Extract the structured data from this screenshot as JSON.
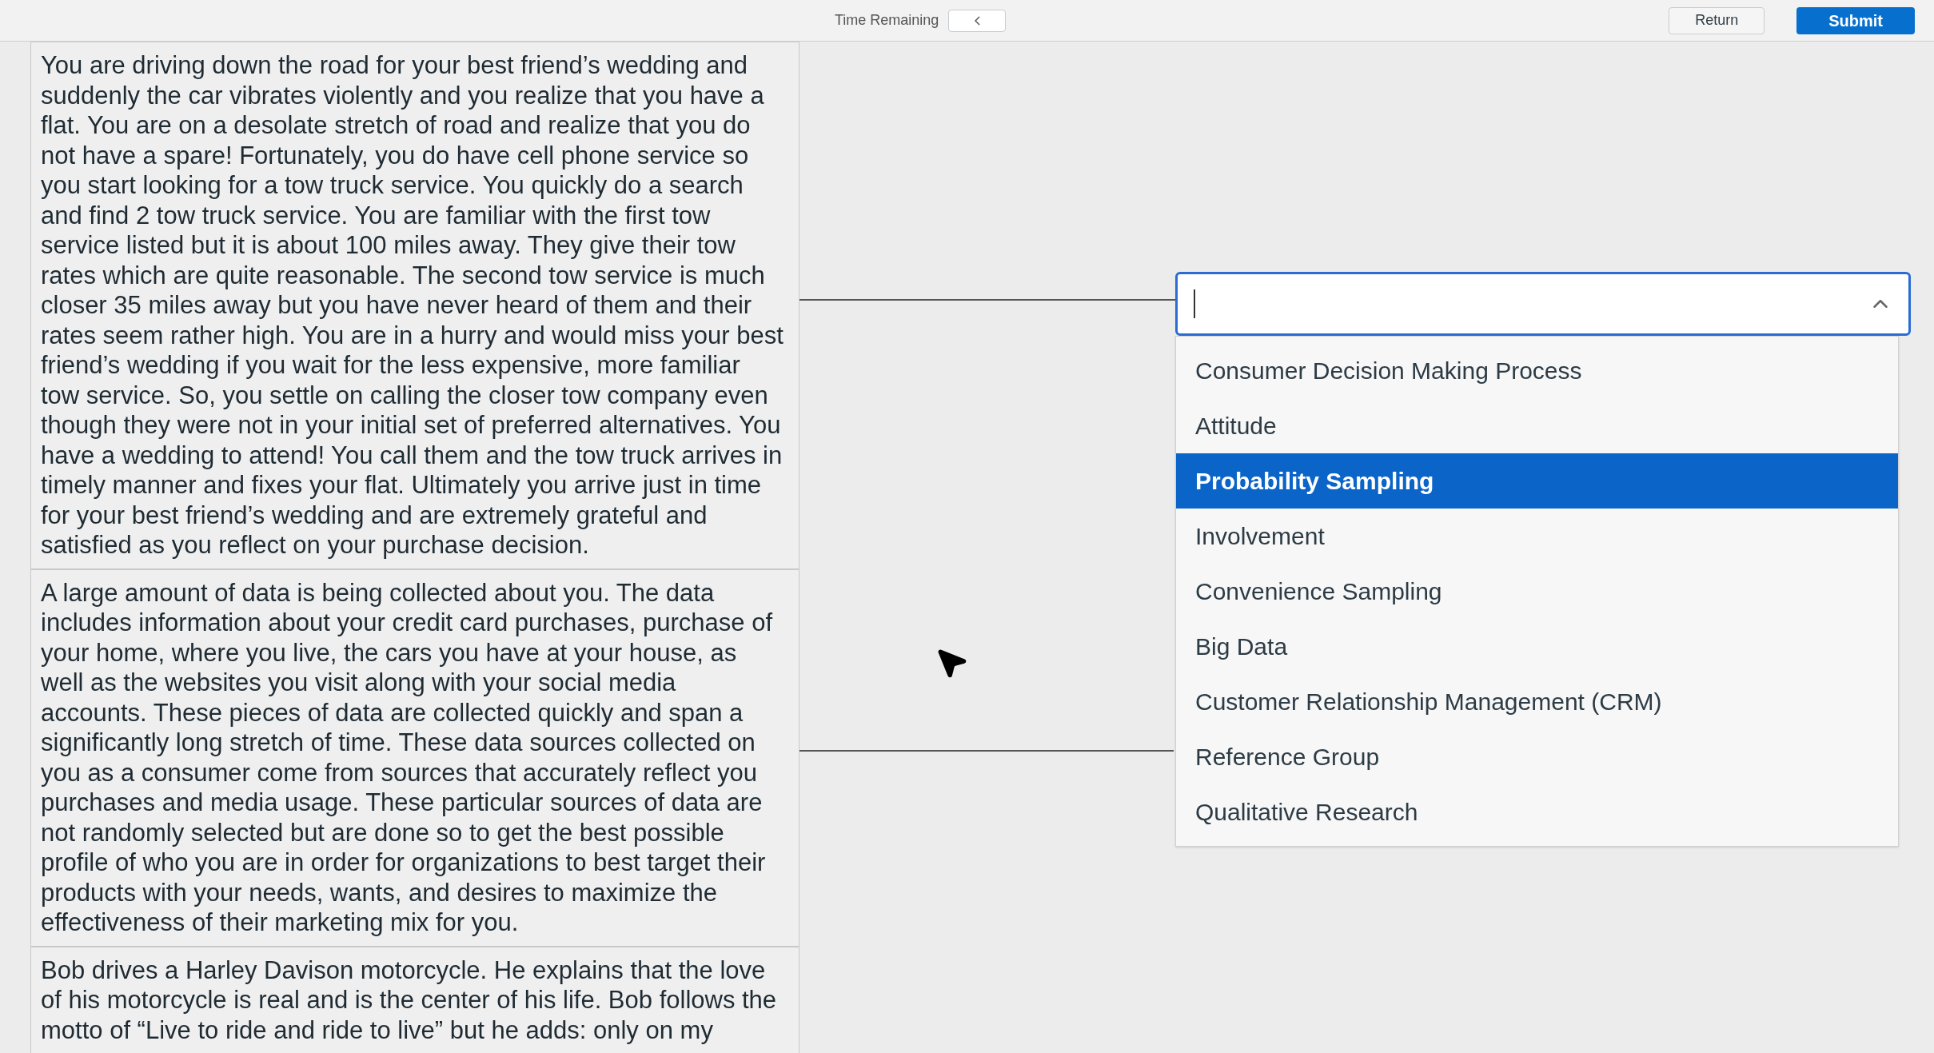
{
  "header": {
    "timer_label": "Time Remaining",
    "buttons": [
      "Return",
      "Submit"
    ]
  },
  "prompts": [
    {
      "text": "You are driving down the road for your best friend’s wedding and suddenly the car vibrates violently and you realize that you have a flat. You are on a desolate stretch of road and realize that you do not have a spare! Fortunately, you do have cell phone service so you start looking for a tow truck service. You quickly do a search and find 2 tow truck service. You are familiar with the first tow service listed but it is about 100 miles away. They give their tow rates which are quite reasonable. The second tow service is much closer 35 miles away but you have never heard of them and their rates seem rather high. You are in a hurry and would miss your best friend’s wedding if you wait for the less expensive, more familiar tow service. So, you settle on calling the closer tow company even though they were not in your initial set of preferred alternatives. You have a wedding to attend! You call them and the tow truck arrives in timely manner and fixes your flat. Ultimately you arrive just in time for your best friend’s wedding and are extremely grateful and satisfied as you reflect on your purchase decision."
    },
    {
      "text": "A large amount of data is being collected about you. The data includes information about your credit card purchases, purchase of your home, where you live, the cars you have at your house, as well as the websites you visit along with your social media accounts. These pieces of data are collected quickly and span a significantly long stretch of time. These data sources collected on you as a consumer come from sources that accurately reflect you purchases and media usage. These particular sources of data are not randomly selected but are done so to get the best possible profile of who you are in order for organizations to best target their products with your needs, wants, and desires to maximize the effectiveness of their marketing mix for you."
    },
    {
      "text": "Bob drives a Harley Davison motorcycle. He explains that the love of his motorcycle is real and is the center of his life. Bob follows the motto of “Live to ride and ride to live” but he adds: only on my"
    }
  ],
  "dropdown": {
    "expanded": true,
    "options": [
      {
        "label": "Consumer Decision Making Process",
        "selected": false
      },
      {
        "label": "Attitude",
        "selected": false
      },
      {
        "label": "Probability Sampling",
        "selected": true
      },
      {
        "label": "Involvement",
        "selected": false
      },
      {
        "label": "Convenience Sampling",
        "selected": false
      },
      {
        "label": "Big Data",
        "selected": false
      },
      {
        "label": "Customer Relationship Management (CRM)",
        "selected": false
      },
      {
        "label": "Reference Group",
        "selected": false
      },
      {
        "label": "Qualitative Research",
        "selected": false
      }
    ]
  }
}
